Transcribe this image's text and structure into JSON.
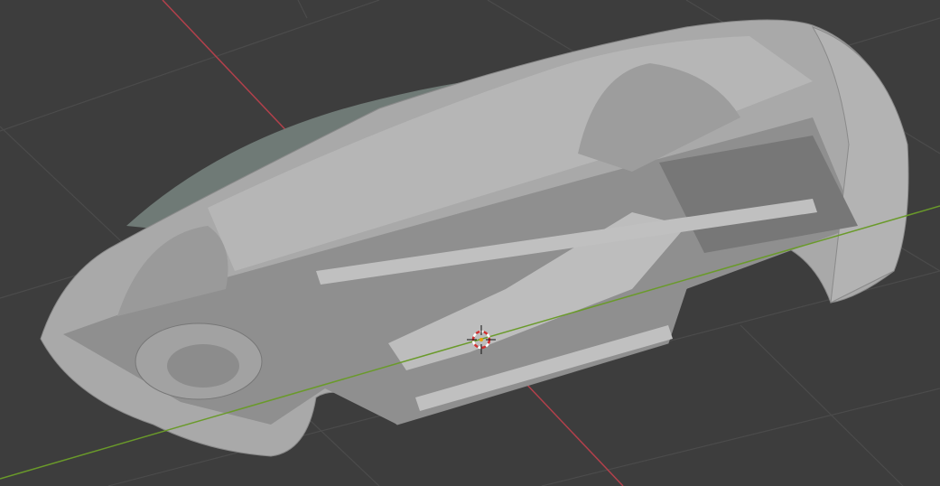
{
  "viewport": {
    "background_color": "#3d3d3d",
    "grid_color": "#4b4b4b",
    "x_axis_color": "#b2404b",
    "y_axis_color": "#6a9a2a",
    "model_color": "#a8a8a8"
  }
}
